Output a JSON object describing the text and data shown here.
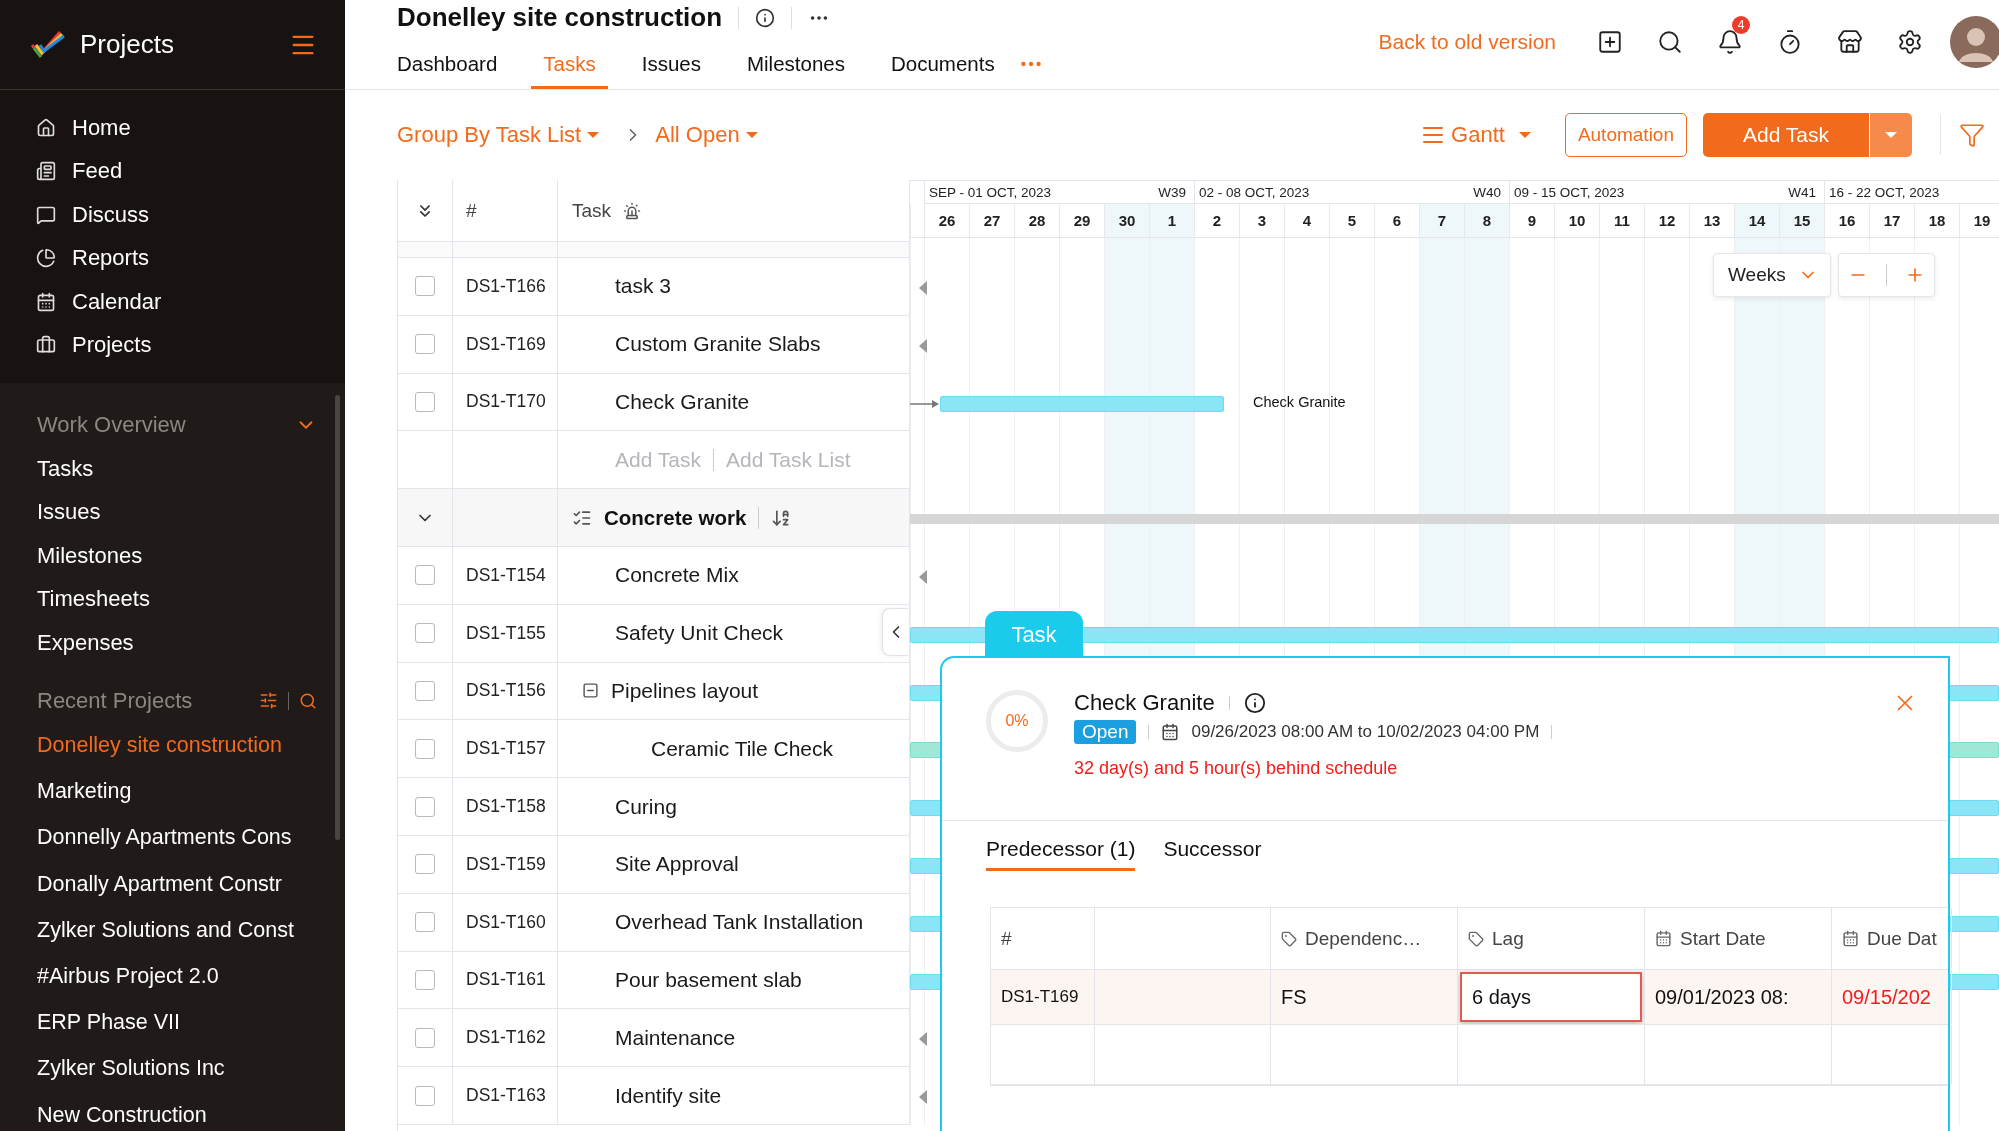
{
  "sidebar": {
    "app_name": "Projects",
    "nav": [
      {
        "label": "Home"
      },
      {
        "label": "Feed"
      },
      {
        "label": "Discuss"
      },
      {
        "label": "Reports"
      },
      {
        "label": "Calendar"
      },
      {
        "label": "Projects"
      }
    ],
    "work_overview": {
      "title": "Work Overview",
      "expanded": true,
      "items": [
        {
          "label": "Tasks"
        },
        {
          "label": "Issues"
        },
        {
          "label": "Milestones"
        },
        {
          "label": "Timesheets"
        },
        {
          "label": "Expenses"
        }
      ]
    },
    "recent_projects": {
      "title": "Recent Projects",
      "items": [
        {
          "label": "Donelley site construction",
          "selected": true
        },
        {
          "label": "Marketing",
          "selected": false
        },
        {
          "label": "Donnelly Apartments Cons",
          "selected": false
        },
        {
          "label": "Donally Apartment Constr",
          "selected": false
        },
        {
          "label": "Zylker Solutions and Const",
          "selected": false
        },
        {
          "label": "#Airbus Project 2.0",
          "selected": false
        },
        {
          "label": "ERP Phase VII",
          "selected": false
        },
        {
          "label": "Zylker Solutions Inc",
          "selected": false
        },
        {
          "label": "New Construction",
          "selected": false
        }
      ]
    }
  },
  "header": {
    "project_title": "Donelley site construction",
    "tabs": [
      {
        "label": "Dashboard",
        "selected": false
      },
      {
        "label": "Tasks",
        "selected": true
      },
      {
        "label": "Issues",
        "selected": false
      },
      {
        "label": "Milestones",
        "selected": false
      },
      {
        "label": "Documents",
        "selected": false
      }
    ],
    "back_link": "Back to old version",
    "notification_count": "4"
  },
  "toolbar": {
    "group_by": "Group By Task List",
    "filter": "All Open",
    "view": "Gantt",
    "automation": "Automation",
    "add_task": "Add Task"
  },
  "table": {
    "columns": [
      "#",
      "Task"
    ],
    "rows": [
      {
        "kind": "task",
        "id": "DS1-T166",
        "name": "task 3",
        "checked": false,
        "bar": {
          "kind": "left"
        }
      },
      {
        "kind": "task",
        "id": "DS1-T169",
        "name": "Custom Granite Slabs",
        "checked": false,
        "bar": {
          "kind": "left"
        }
      },
      {
        "kind": "task",
        "id": "DS1-T170",
        "name": "Check Granite",
        "checked": false,
        "bar": {
          "kind": "short",
          "label": "Check Granite"
        }
      },
      {
        "kind": "add",
        "add_task": "Add Task",
        "add_list": "Add Task List"
      },
      {
        "kind": "group",
        "name": "Concrete work",
        "expanded": true
      },
      {
        "kind": "task",
        "id": "DS1-T154",
        "name": "Concrete Mix",
        "checked": false,
        "bar": {
          "kind": "left"
        }
      },
      {
        "kind": "task",
        "id": "DS1-T155",
        "name": "Safety Unit Check",
        "checked": false,
        "bar": {
          "kind": "full"
        }
      },
      {
        "kind": "task",
        "id": "DS1-T156",
        "name": "Pipelines layout",
        "checked": false,
        "bar": {
          "kind": "full"
        },
        "expanded": true,
        "children": [
          {
            "kind": "task",
            "id": "DS1-T157",
            "name": "Ceramic Tile Check",
            "checked": false,
            "bar": {
              "kind": "full_green"
            }
          }
        ]
      },
      {
        "kind": "task",
        "id": "DS1-T158",
        "name": "Curing",
        "checked": false,
        "bar": {
          "kind": "full"
        }
      },
      {
        "kind": "task",
        "id": "DS1-T159",
        "name": "Site Approval",
        "checked": false,
        "bar": {
          "kind": "full"
        }
      },
      {
        "kind": "task",
        "id": "DS1-T160",
        "name": "Overhead Tank Installation",
        "checked": false,
        "bar": {
          "kind": "full"
        }
      },
      {
        "kind": "task",
        "id": "DS1-T161",
        "name": "Pour basement slab",
        "checked": false,
        "bar": {
          "kind": "full"
        }
      },
      {
        "kind": "task",
        "id": "DS1-T162",
        "name": "Maintenance",
        "checked": false,
        "bar": {
          "kind": "left"
        }
      },
      {
        "kind": "task",
        "id": "DS1-T163",
        "name": "Identify site",
        "checked": false,
        "bar": {
          "kind": "left"
        }
      }
    ]
  },
  "gantt": {
    "weeks": [
      {
        "range": "SEP - 01 OCT, 2023",
        "week": "W39"
      },
      {
        "range": "02 - 08 OCT, 2023",
        "week": "W40"
      },
      {
        "range": "09 - 15 OCT, 2023",
        "week": "W41"
      },
      {
        "range": "16 - 22 OCT, 2023"
      }
    ],
    "days": [
      {
        "label": "26",
        "weekend": false
      },
      {
        "label": "27",
        "weekend": false
      },
      {
        "label": "28",
        "weekend": false
      },
      {
        "label": "29",
        "weekend": false
      },
      {
        "label": "30",
        "weekend": true
      },
      {
        "label": "1",
        "weekend": true
      },
      {
        "label": "2",
        "weekend": false
      },
      {
        "label": "3",
        "weekend": false
      },
      {
        "label": "4",
        "weekend": false
      },
      {
        "label": "5",
        "weekend": false
      },
      {
        "label": "6",
        "weekend": false
      },
      {
        "label": "7",
        "weekend": true
      },
      {
        "label": "8",
        "weekend": true
      },
      {
        "label": "9",
        "weekend": false
      },
      {
        "label": "10",
        "weekend": false
      },
      {
        "label": "11",
        "weekend": false
      },
      {
        "label": "12",
        "weekend": false
      },
      {
        "label": "13",
        "weekend": false
      },
      {
        "label": "14",
        "weekend": true
      },
      {
        "label": "15",
        "weekend": true
      },
      {
        "label": "16",
        "weekend": false
      },
      {
        "label": "17",
        "weekend": false
      },
      {
        "label": "18",
        "weekend": false
      },
      {
        "label": "19",
        "weekend": false
      }
    ],
    "scale": "Weeks"
  },
  "popup": {
    "tab": "Task",
    "progress": "0%",
    "title": "Check Granite",
    "status": "Open",
    "date_range": "09/26/2023 08:00 AM to 10/02/2023 04:00 PM",
    "schedule_note": "32 day(s) and 5 hour(s) behind schedule",
    "tabs": [
      {
        "label": "Predecessor (1)",
        "selected": true
      },
      {
        "label": "Successor",
        "selected": false
      }
    ],
    "columns": {
      "id": "#",
      "dependency": "Dependenc…",
      "lag": "Lag",
      "start_date": "Start Date",
      "due_date": "Due Dat"
    },
    "rows": [
      {
        "id": "DS1-T169",
        "dependency": "FS",
        "lag": "6 days",
        "editing": true,
        "start_date": "09/01/2023 08:",
        "due_date": "09/15/202",
        "overdue": true
      }
    ]
  }
}
